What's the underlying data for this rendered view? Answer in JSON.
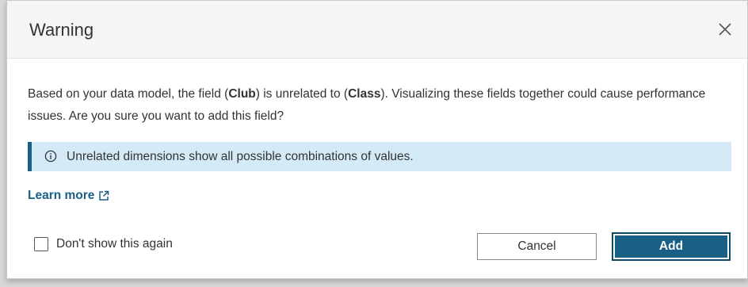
{
  "dialog": {
    "title": "Warning",
    "close_icon": "close-icon",
    "message": {
      "part1": "Based on your data model, the field (",
      "field": "Club",
      "part2": ") is unrelated to (",
      "other_field": "Class",
      "part3": "). Visualizing these fields together could cause performance issues. Are you sure you want to add this field?"
    },
    "info": {
      "icon": "info-icon",
      "text": "Unrelated dimensions show all possible combinations of values."
    },
    "learn_more": {
      "label": "Learn more",
      "icon": "external-link-icon"
    },
    "checkbox": {
      "label": "Don't show this again",
      "checked": false
    },
    "buttons": {
      "cancel": "Cancel",
      "add": "Add"
    }
  },
  "colors": {
    "accent": "#1a5f86",
    "info_background": "#d4ebf7",
    "header_background": "#f5f5f5"
  }
}
